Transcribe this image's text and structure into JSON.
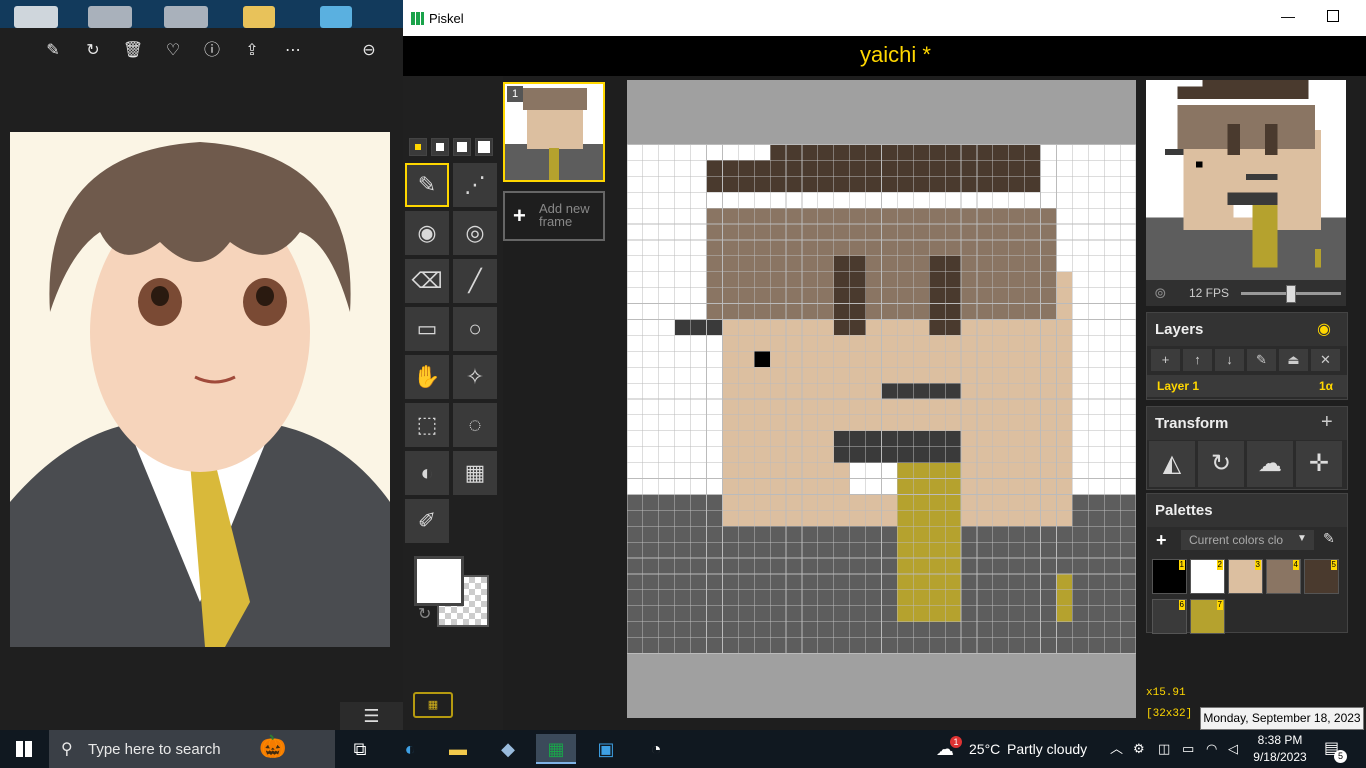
{
  "photos": {
    "toolbar_icons": [
      "edit-icon",
      "rotate-icon",
      "delete-icon",
      "favorite-icon",
      "info-icon",
      "share-icon",
      "more-icon",
      "zoom-out-icon"
    ],
    "bottom_menu": "☰"
  },
  "piskel": {
    "window_title": "Piskel",
    "document_title": "yaichi *",
    "add_frame_label": "Add new frame",
    "frame_number": "1",
    "fps_label": "12 FPS",
    "fps_value": 12,
    "layers": {
      "title": "Layers",
      "layer_name": "Layer 1",
      "layer_alpha": "1α"
    },
    "transform": {
      "title": "Transform"
    },
    "palettes": {
      "title": "Palettes",
      "selected": "Current colors clo",
      "colors": [
        {
          "n": "1",
          "hex": "#000000"
        },
        {
          "n": "2",
          "hex": "#ffffff"
        },
        {
          "n": "3",
          "hex": "#dcbfa0"
        },
        {
          "n": "4",
          "hex": "#8a7563"
        },
        {
          "n": "5",
          "hex": "#4a3a2e"
        },
        {
          "n": "6",
          "hex": "#3a3a3a"
        },
        {
          "n": "7",
          "hex": "#b5a22e"
        }
      ]
    },
    "zoom": "x15.91",
    "canvas_size": "[32x32]",
    "primary_color": "#ffffff",
    "secondary_color": "transparent"
  },
  "taskbar": {
    "search_placeholder": "Type here to search",
    "weather_temp": "25°C",
    "weather_text": "Partly cloudy",
    "weather_badge": "1",
    "time": "8:38 PM",
    "date": "9/18/2023",
    "notification_count": "5",
    "tooltip": "Monday, September 18, 2023"
  }
}
